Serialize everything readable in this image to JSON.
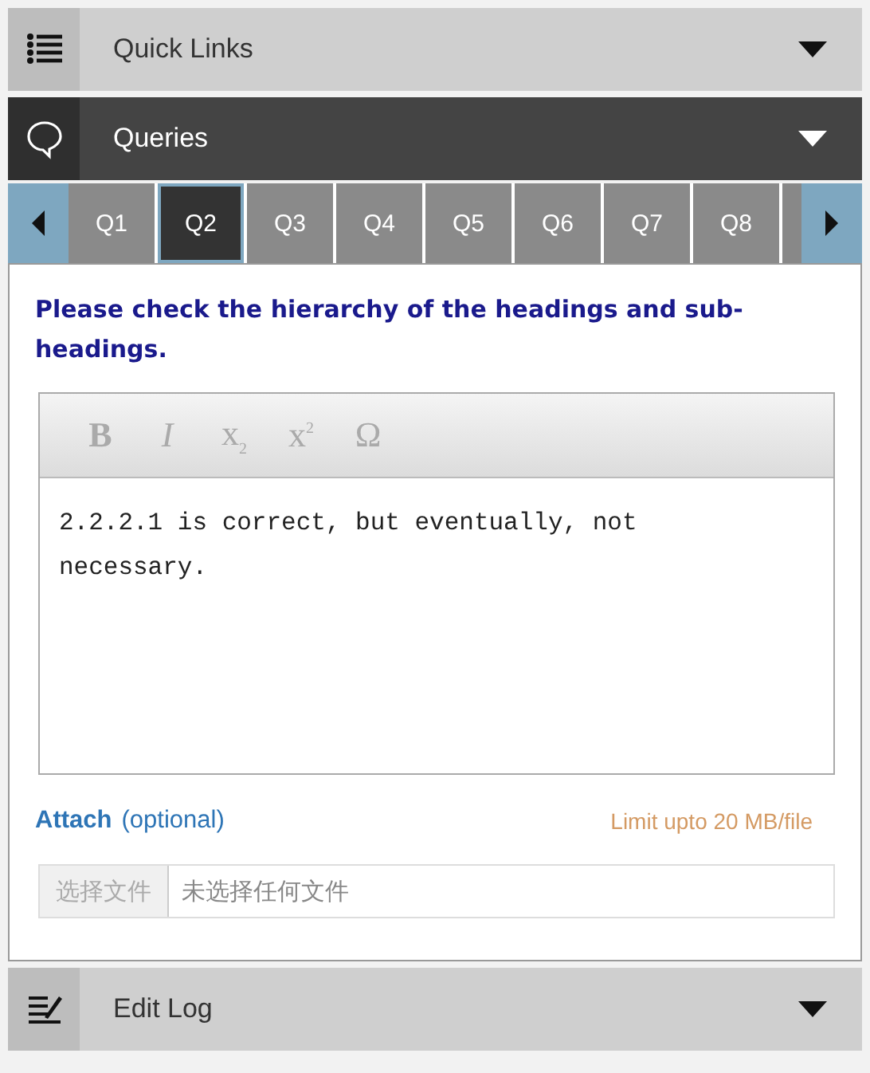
{
  "sections": [
    {
      "kind": "links",
      "title": "Quick Links",
      "expanded": false
    },
    {
      "kind": "queries",
      "title": "Queries",
      "expanded": true,
      "tabs": [
        {
          "label": "Q1",
          "selected": false
        },
        {
          "label": "Q2",
          "selected": true
        },
        {
          "label": "Q3",
          "selected": false
        },
        {
          "label": "Q4",
          "selected": false
        },
        {
          "label": "Q5",
          "selected": false
        },
        {
          "label": "Q6",
          "selected": false
        },
        {
          "label": "Q7",
          "selected": false
        },
        {
          "label": "Q8",
          "selected": false
        }
      ],
      "question": "Please check the hierarchy of the headings and sub-headings.",
      "editor": {
        "toolbar": [
          {
            "kind": "bold",
            "label": "B"
          },
          {
            "kind": "italic",
            "label": "I"
          },
          {
            "kind": "subscript",
            "label": "x",
            "mark": "2"
          },
          {
            "kind": "superscript",
            "label": "x",
            "mark": "2"
          },
          {
            "kind": "symbol",
            "label": "Ω"
          }
        ],
        "value": "2.2.2.1 is correct, but eventually, not necessary."
      },
      "attach": {
        "label": "Attach",
        "hint": "(optional)",
        "limit": "Limit upto 20 MB/file",
        "button": "选择文件",
        "status": "未选择任何文件"
      }
    },
    {
      "kind": "log",
      "title": "Edit Log",
      "expanded": false
    }
  ]
}
